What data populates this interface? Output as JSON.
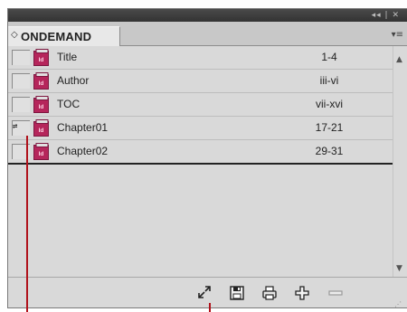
{
  "panel": {
    "collapse_glyph": "◂◂ | ✕",
    "tab_arrows": "◇",
    "tab_label": "ONDEMAND",
    "menu_glyph": "▾≡"
  },
  "documents": [
    {
      "name": "Title",
      "pages": "1-4",
      "sync_source": false
    },
    {
      "name": "Author",
      "pages": "iii-vi",
      "sync_source": false
    },
    {
      "name": "TOC",
      "pages": "vii-xvi",
      "sync_source": false
    },
    {
      "name": "Chapter01",
      "pages": "17-21",
      "sync_source": true
    },
    {
      "name": "Chapter02",
      "pages": "29-31",
      "sync_source": false
    }
  ],
  "sync_glyph": "⇄",
  "doc_icon_label": "Id",
  "toolbar": {
    "buttons": [
      {
        "name": "synchronize-button",
        "icon": "sync-arrows-icon"
      },
      {
        "name": "save-book-button",
        "icon": "floppy-disk-icon"
      },
      {
        "name": "print-book-button",
        "icon": "printer-icon"
      },
      {
        "name": "add-document-button",
        "icon": "plus-icon"
      },
      {
        "name": "remove-document-button",
        "icon": "minus-icon"
      }
    ]
  },
  "colors": {
    "panel_bg": "#d9d9d9",
    "doc_icon": "#b5265b",
    "callout": "#b0121b"
  }
}
